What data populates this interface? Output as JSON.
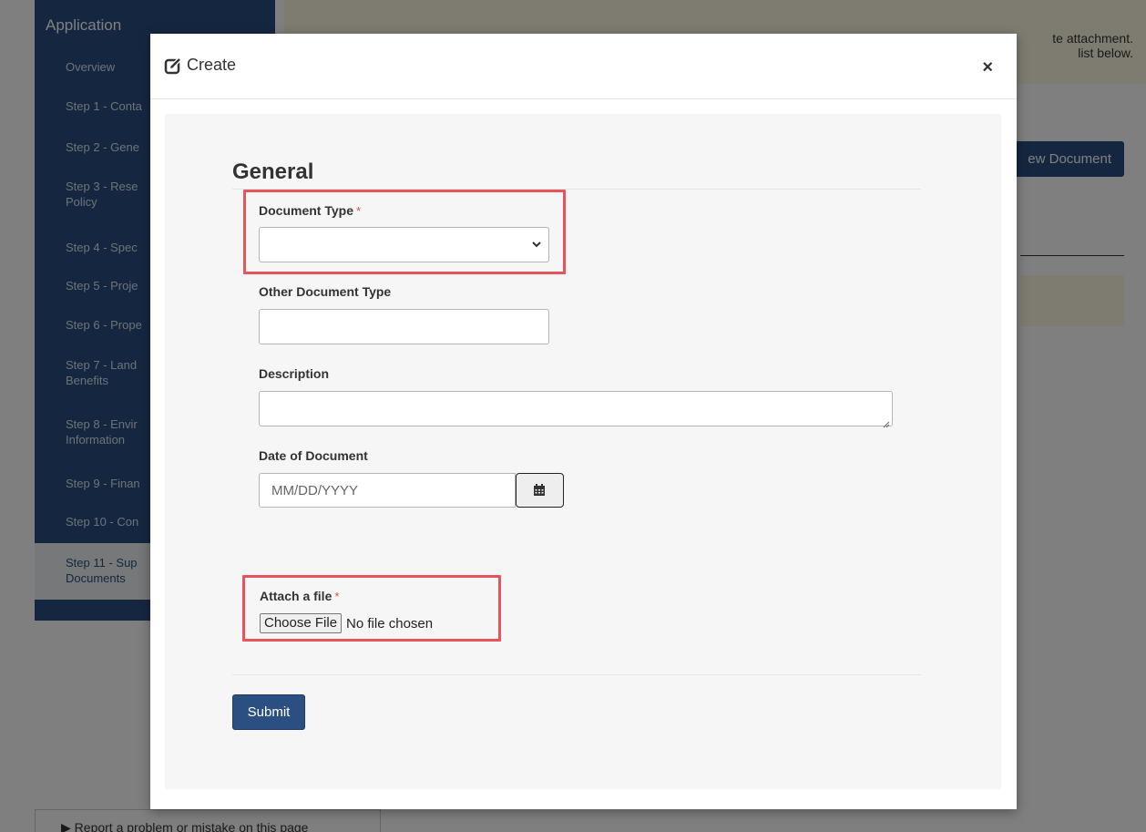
{
  "background": {
    "sidebar": {
      "title": "Application",
      "items": [
        {
          "label": "Overview"
        },
        {
          "label": "Step 1 - Conta"
        },
        {
          "label": "Step 2 - Gene"
        },
        {
          "label": "Step 3 - Rese",
          "label2": "Policy"
        },
        {
          "label": "Step 4 - Spec"
        },
        {
          "label": "Step 5 - Proje"
        },
        {
          "label": "Step 6 - Prope"
        },
        {
          "label": "Step 7 - Land",
          "label2": "Benefits"
        },
        {
          "label": "Step 8 - Envir",
          "label2": "Information"
        },
        {
          "label": "Step 9 - Finan"
        },
        {
          "label": "Step 10 - Con"
        },
        {
          "label": "Step 11 - Sup",
          "label2": "Documents"
        }
      ]
    },
    "banner": {
      "line1": "Please do not attach all of your documents as one large attachment. Provide each document as a separate attachment.",
      "line1_visible": "te attachment.",
      "line2_visible": "list below."
    },
    "new_document_button": "ew Document",
    "report_link": "Report a problem or mistake on this page"
  },
  "modal": {
    "title": "Create",
    "close_symbol": "×",
    "section_title": "General",
    "fields": {
      "document_type": {
        "label": "Document Type",
        "required_mark": "*",
        "value": ""
      },
      "other_document_type": {
        "label": "Other Document Type",
        "value": ""
      },
      "description": {
        "label": "Description",
        "value": ""
      },
      "date_of_document": {
        "label": "Date of Document",
        "placeholder": "MM/DD/YYYY"
      },
      "attach_file": {
        "label": "Attach a file",
        "required_mark": "*",
        "button_label": "Choose File",
        "status": "No file chosen"
      }
    },
    "submit_label": "Submit"
  },
  "colors": {
    "primary": "#2b4f80",
    "highlight": "#e8545c",
    "required": "#d9534f",
    "banner": "#fcf8e3"
  }
}
